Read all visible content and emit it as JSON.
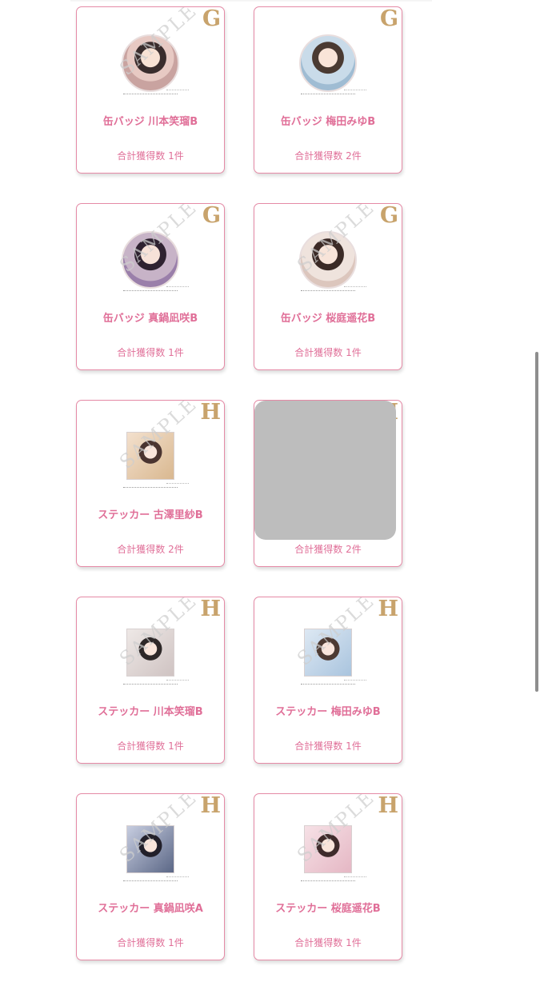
{
  "items": [
    {
      "rank": "G",
      "kind": "badge",
      "style": "default",
      "name": "缶バッジ 川本笑瑠B",
      "count": "合計獲得数 1件",
      "watermark": "SAMPLE"
    },
    {
      "rank": "G",
      "kind": "badge",
      "style": "blue",
      "name": "缶バッジ 梅田みゆB",
      "count": "合計獲得数 2件",
      "watermark": ""
    },
    {
      "rank": "G",
      "kind": "badge",
      "style": "purple",
      "name": "缶バッジ 真鍋凪咲B",
      "count": "合計獲得数 1件",
      "watermark": "SAMPLE"
    },
    {
      "rank": "G",
      "kind": "badge",
      "style": "beige",
      "name": "缶バッジ 桜庭遥花B",
      "count": "合計獲得数 1件",
      "watermark": "SAMPLE"
    },
    {
      "rank": "H",
      "kind": "sticker",
      "style": "default",
      "name": "ステッカー 古澤里紗B",
      "count": "合計獲得数 2件",
      "watermark": "SAMPLE"
    },
    {
      "rank": "H",
      "kind": "sticker",
      "style": "gray",
      "name": "",
      "count": "合計獲得数 2件",
      "watermark": "",
      "covered": true
    },
    {
      "rank": "H",
      "kind": "sticker",
      "style": "gray",
      "name": "ステッカー 川本笑瑠B",
      "count": "合計獲得数 1件",
      "watermark": "SAMPLE"
    },
    {
      "rank": "H",
      "kind": "sticker",
      "style": "blue",
      "name": "ステッカー 梅田みゆB",
      "count": "合計獲得数 1件",
      "watermark": "SAMPLE"
    },
    {
      "rank": "H",
      "kind": "sticker",
      "style": "navy",
      "name": "ステッカー 真鍋凪咲A",
      "count": "合計獲得数 1件",
      "watermark": "SAMPLE"
    },
    {
      "rank": "H",
      "kind": "sticker",
      "style": "pink",
      "name": "ステッカー 桜庭遥花B",
      "count": "合計獲得数 1件",
      "watermark": "SAMPLE"
    }
  ]
}
